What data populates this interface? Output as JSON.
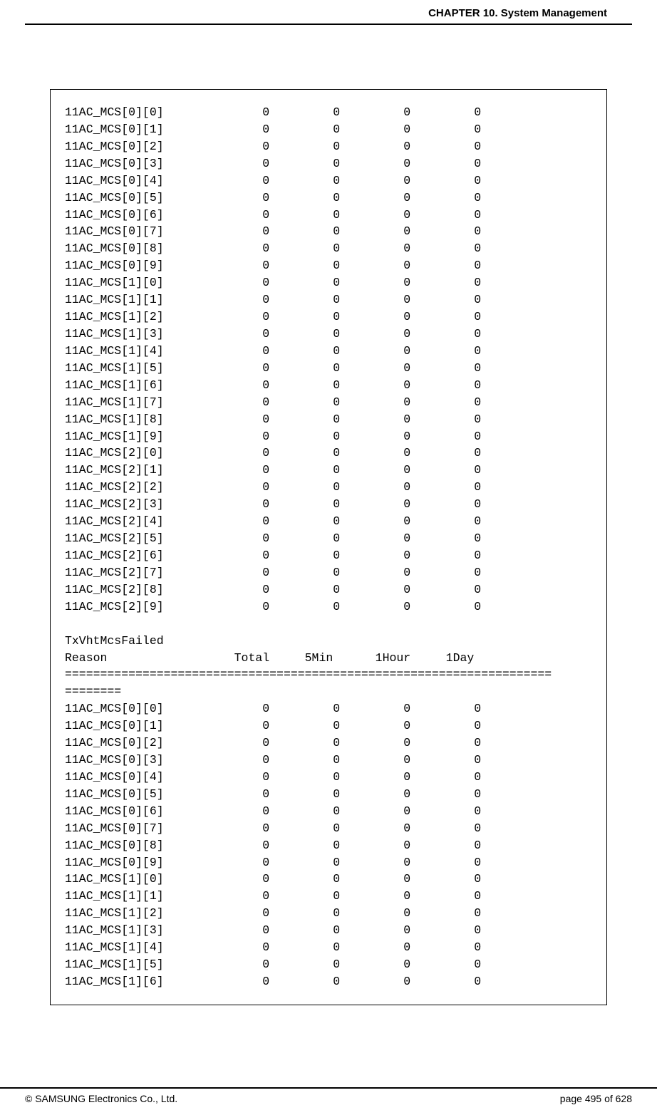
{
  "header": {
    "chapter": "CHAPTER 10. System Management"
  },
  "table1": {
    "rows": [
      {
        "label": "11AC_MCS[0][0]",
        "c1": "0",
        "c2": "0",
        "c3": "0",
        "c4": "0"
      },
      {
        "label": "11AC_MCS[0][1]",
        "c1": "0",
        "c2": "0",
        "c3": "0",
        "c4": "0"
      },
      {
        "label": "11AC_MCS[0][2]",
        "c1": "0",
        "c2": "0",
        "c3": "0",
        "c4": "0"
      },
      {
        "label": "11AC_MCS[0][3]",
        "c1": "0",
        "c2": "0",
        "c3": "0",
        "c4": "0"
      },
      {
        "label": "11AC_MCS[0][4]",
        "c1": "0",
        "c2": "0",
        "c3": "0",
        "c4": "0"
      },
      {
        "label": "11AC_MCS[0][5]",
        "c1": "0",
        "c2": "0",
        "c3": "0",
        "c4": "0"
      },
      {
        "label": "11AC_MCS[0][6]",
        "c1": "0",
        "c2": "0",
        "c3": "0",
        "c4": "0"
      },
      {
        "label": "11AC_MCS[0][7]",
        "c1": "0",
        "c2": "0",
        "c3": "0",
        "c4": "0"
      },
      {
        "label": "11AC_MCS[0][8]",
        "c1": "0",
        "c2": "0",
        "c3": "0",
        "c4": "0"
      },
      {
        "label": "11AC_MCS[0][9]",
        "c1": "0",
        "c2": "0",
        "c3": "0",
        "c4": "0"
      },
      {
        "label": "11AC_MCS[1][0]",
        "c1": "0",
        "c2": "0",
        "c3": "0",
        "c4": "0"
      },
      {
        "label": "11AC_MCS[1][1]",
        "c1": "0",
        "c2": "0",
        "c3": "0",
        "c4": "0"
      },
      {
        "label": "11AC_MCS[1][2]",
        "c1": "0",
        "c2": "0",
        "c3": "0",
        "c4": "0"
      },
      {
        "label": "11AC_MCS[1][3]",
        "c1": "0",
        "c2": "0",
        "c3": "0",
        "c4": "0"
      },
      {
        "label": "11AC_MCS[1][4]",
        "c1": "0",
        "c2": "0",
        "c3": "0",
        "c4": "0"
      },
      {
        "label": "11AC_MCS[1][5]",
        "c1": "0",
        "c2": "0",
        "c3": "0",
        "c4": "0"
      },
      {
        "label": "11AC_MCS[1][6]",
        "c1": "0",
        "c2": "0",
        "c3": "0",
        "c4": "0"
      },
      {
        "label": "11AC_MCS[1][7]",
        "c1": "0",
        "c2": "0",
        "c3": "0",
        "c4": "0"
      },
      {
        "label": "11AC_MCS[1][8]",
        "c1": "0",
        "c2": "0",
        "c3": "0",
        "c4": "0"
      },
      {
        "label": "11AC_MCS[1][9]",
        "c1": "0",
        "c2": "0",
        "c3": "0",
        "c4": "0"
      },
      {
        "label": "11AC_MCS[2][0]",
        "c1": "0",
        "c2": "0",
        "c3": "0",
        "c4": "0"
      },
      {
        "label": "11AC_MCS[2][1]",
        "c1": "0",
        "c2": "0",
        "c3": "0",
        "c4": "0"
      },
      {
        "label": "11AC_MCS[2][2]",
        "c1": "0",
        "c2": "0",
        "c3": "0",
        "c4": "0"
      },
      {
        "label": "11AC_MCS[2][3]",
        "c1": "0",
        "c2": "0",
        "c3": "0",
        "c4": "0"
      },
      {
        "label": "11AC_MCS[2][4]",
        "c1": "0",
        "c2": "0",
        "c3": "0",
        "c4": "0"
      },
      {
        "label": "11AC_MCS[2][5]",
        "c1": "0",
        "c2": "0",
        "c3": "0",
        "c4": "0"
      },
      {
        "label": "11AC_MCS[2][6]",
        "c1": "0",
        "c2": "0",
        "c3": "0",
        "c4": "0"
      },
      {
        "label": "11AC_MCS[2][7]",
        "c1": "0",
        "c2": "0",
        "c3": "0",
        "c4": "0"
      },
      {
        "label": "11AC_MCS[2][8]",
        "c1": "0",
        "c2": "0",
        "c3": "0",
        "c4": "0"
      },
      {
        "label": "11AC_MCS[2][9]",
        "c1": "0",
        "c2": "0",
        "c3": "0",
        "c4": "0"
      }
    ]
  },
  "section2": {
    "title": "TxVhtMcsFailed",
    "headers": {
      "h0": "Reason",
      "h1": "Total",
      "h2": "5Min",
      "h3": "1Hour",
      "h4": "1Day"
    },
    "separator1": "=====================================================================",
    "separator2": "========",
    "rows": [
      {
        "label": "11AC_MCS[0][0]",
        "c1": "0",
        "c2": "0",
        "c3": "0",
        "c4": "0"
      },
      {
        "label": "11AC_MCS[0][1]",
        "c1": "0",
        "c2": "0",
        "c3": "0",
        "c4": "0"
      },
      {
        "label": "11AC_MCS[0][2]",
        "c1": "0",
        "c2": "0",
        "c3": "0",
        "c4": "0"
      },
      {
        "label": "11AC_MCS[0][3]",
        "c1": "0",
        "c2": "0",
        "c3": "0",
        "c4": "0"
      },
      {
        "label": "11AC_MCS[0][4]",
        "c1": "0",
        "c2": "0",
        "c3": "0",
        "c4": "0"
      },
      {
        "label": "11AC_MCS[0][5]",
        "c1": "0",
        "c2": "0",
        "c3": "0",
        "c4": "0"
      },
      {
        "label": "11AC_MCS[0][6]",
        "c1": "0",
        "c2": "0",
        "c3": "0",
        "c4": "0"
      },
      {
        "label": "11AC_MCS[0][7]",
        "c1": "0",
        "c2": "0",
        "c3": "0",
        "c4": "0"
      },
      {
        "label": "11AC_MCS[0][8]",
        "c1": "0",
        "c2": "0",
        "c3": "0",
        "c4": "0"
      },
      {
        "label": "11AC_MCS[0][9]",
        "c1": "0",
        "c2": "0",
        "c3": "0",
        "c4": "0"
      },
      {
        "label": "11AC_MCS[1][0]",
        "c1": "0",
        "c2": "0",
        "c3": "0",
        "c4": "0"
      },
      {
        "label": "11AC_MCS[1][1]",
        "c1": "0",
        "c2": "0",
        "c3": "0",
        "c4": "0"
      },
      {
        "label": "11AC_MCS[1][2]",
        "c1": "0",
        "c2": "0",
        "c3": "0",
        "c4": "0"
      },
      {
        "label": "11AC_MCS[1][3]",
        "c1": "0",
        "c2": "0",
        "c3": "0",
        "c4": "0"
      },
      {
        "label": "11AC_MCS[1][4]",
        "c1": "0",
        "c2": "0",
        "c3": "0",
        "c4": "0"
      },
      {
        "label": "11AC_MCS[1][5]",
        "c1": "0",
        "c2": "0",
        "c3": "0",
        "c4": "0"
      },
      {
        "label": "11AC_MCS[1][6]",
        "c1": "0",
        "c2": "0",
        "c3": "0",
        "c4": "0"
      }
    ]
  },
  "footer": {
    "copyright": "© SAMSUNG Electronics Co., Ltd.",
    "page": "page 495 of 628"
  }
}
